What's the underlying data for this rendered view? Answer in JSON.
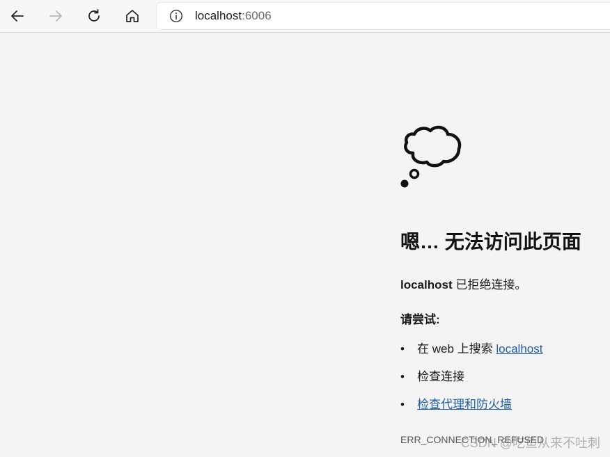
{
  "browser": {
    "url_host": "localhost",
    "url_port": ":6006",
    "icons": [
      "back-arrow-icon",
      "forward-arrow-icon",
      "reload-icon",
      "home-icon",
      "info-icon"
    ]
  },
  "error_page": {
    "icon": "thought-cloud-icon",
    "headline": "嗯… 无法访问此页面",
    "refused_host": "localhost",
    "refused_text": " 已拒绝连接。",
    "try_label": "请尝试:",
    "suggestions": [
      {
        "prefix": "在 web 上搜索 ",
        "link": "localhost"
      },
      {
        "text": "检查连接"
      },
      {
        "link": "检查代理和防火墙"
      }
    ],
    "bullet": "•",
    "error_code": "ERR_CONNECTION_REFUSED"
  },
  "watermark": "CSDN @吃鱼从来不吐刺",
  "colors": {
    "link": "#1f5fa8",
    "background": "#f4f4f4",
    "toolbar": "#f7f7f7"
  }
}
